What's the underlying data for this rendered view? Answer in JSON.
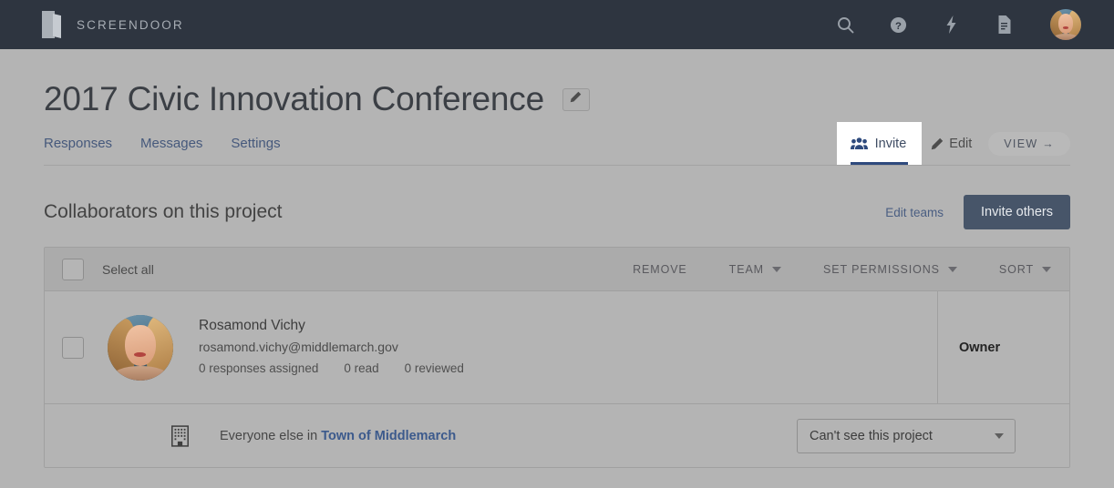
{
  "brand": {
    "name": "SCREENDOOR",
    "logo_icon": "door-logo-icon"
  },
  "topnav": {
    "icons": [
      {
        "name": "search-icon",
        "label": "Search"
      },
      {
        "name": "help-icon",
        "label": "Help"
      },
      {
        "name": "lightning-icon",
        "label": "Activity"
      },
      {
        "name": "document-icon",
        "label": "Documents"
      }
    ],
    "avatar": {
      "name": "user-avatar",
      "label": "Account"
    }
  },
  "project": {
    "title": "2017 Civic Innovation Conference",
    "edit_title_icon": "pencil-icon"
  },
  "tabs": [
    {
      "label": "Responses"
    },
    {
      "label": "Messages"
    },
    {
      "label": "Settings"
    }
  ],
  "tab_actions": {
    "invite": {
      "label": "Invite",
      "icon": "users-group-icon",
      "active": true
    },
    "edit": {
      "label": "Edit",
      "icon": "pencil-icon"
    },
    "view": {
      "label": "VIEW →"
    }
  },
  "collaborators": {
    "heading": "Collaborators on this project",
    "edit_teams_label": "Edit teams",
    "invite_others_label": "Invite others"
  },
  "toolbar": {
    "select_all_label": "Select all",
    "remove_label": "REMOVE",
    "team_label": "TEAM",
    "set_permissions_label": "SET PERMISSIONS",
    "sort_label": "SORT"
  },
  "members": [
    {
      "name": "Rosamond Vichy",
      "email": "rosamond.vichy@middlemarch.gov",
      "stat_assigned": "0 responses assigned",
      "stat_read": "0 read",
      "stat_reviewed": "0 reviewed",
      "role": "Owner"
    }
  ],
  "organization": {
    "icon": "building-icon",
    "prefix": "Everyone else in ",
    "org_name": "Town of Middlemarch",
    "permission_value": "Can't see this project"
  },
  "colors": {
    "topnav_bg": "#2e3540",
    "accent_blue": "#2e4a7d",
    "link_blue": "#46597c",
    "button_slate": "#475569",
    "page_bg": "#b4b4b4"
  }
}
